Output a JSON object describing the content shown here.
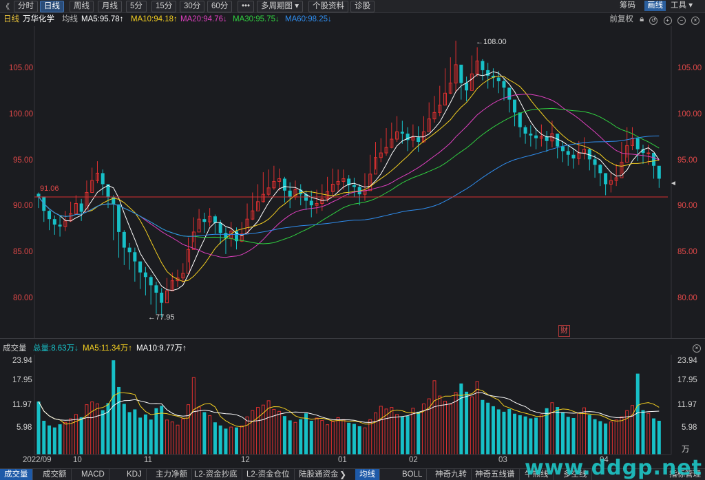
{
  "toolbar": {
    "back_glyph": "《",
    "tabs": [
      "分时",
      "日线",
      "周线",
      "月线",
      "5分",
      "15分",
      "30分",
      "60分",
      "•••",
      "多周期图 ▾",
      "个股资料",
      "诊股"
    ],
    "active_tab": "日线",
    "right": [
      "筹码",
      "画线",
      "工具 ▾"
    ],
    "active_right": "画线"
  },
  "legend": {
    "period": "日线",
    "stock_name": "万华化学",
    "ma_label": "均线",
    "ma5": "MA5:95.78↑",
    "ma10": "MA10:94.18↑",
    "ma20": "MA20:94.76↓",
    "ma30": "MA30:95.75↓",
    "ma60": "MA60:98.25↓",
    "adjust": "前复权"
  },
  "colors": {
    "up": "#e03030",
    "down": "#17c0c7",
    "ma5": "#ffffff",
    "ma10": "#f5d020",
    "ma20": "#e040c0",
    "ma30": "#30d040",
    "ma60": "#2f8ef0",
    "ref_line": "#d93030"
  },
  "price_axis": {
    "ticks": [
      "105.00",
      "100.00",
      "95.00",
      "90.00",
      "85.00",
      "80.00"
    ],
    "left_ref_label": "91.06",
    "high_label": "108.00",
    "low_label": "77.95"
  },
  "volume": {
    "title": "成交量",
    "total": "总量:8.63万↓",
    "ma5": "MA5:11.34万↑",
    "ma10": "MA10:9.77万↑",
    "ticks": [
      "23.94",
      "17.95",
      "11.97",
      "5.98"
    ],
    "unit": "万"
  },
  "dates": [
    "2022/09",
    "10",
    "11",
    "12",
    "01",
    "02",
    "03",
    "04"
  ],
  "badge": "财",
  "bottom_tabs_left": [
    "成交量",
    "成交额",
    "MACD",
    "KDJ",
    "主力净额",
    "L2-资金抄底",
    "L2-资金仓位",
    "陆股通资金"
  ],
  "active_bottom_left": "成交量",
  "bottom_tabs_right": [
    "均线",
    "BOLL",
    "神奇九转",
    "神奇五线谱",
    "牛熊线",
    "多空线"
  ],
  "active_bottom_right": "均线",
  "bottom_right_button": "指标管理",
  "watermark": "www.ddgp.net",
  "chart_data": {
    "type": "candlestick",
    "price_ylim": [
      77,
      110
    ],
    "volume_ylim": [
      0,
      26
    ],
    "closes": [
      91.06,
      89.5,
      88.6,
      88.0,
      87.8,
      88.4,
      89.2,
      90.3,
      89.4,
      91.5,
      92.8,
      93.6,
      92.4,
      91.0,
      90.2,
      87.2,
      85.5,
      85.0,
      84.0,
      82.8,
      82.3,
      81.4,
      80.6,
      79.5,
      80.8,
      81.9,
      82.2,
      82.7,
      85.3,
      87.2,
      88.6,
      88.3,
      88.9,
      88.2,
      87.1,
      86.5,
      87.3,
      86.2,
      87.0,
      88.6,
      89.5,
      90.5,
      91.3,
      92.0,
      92.7,
      93.0,
      91.7,
      91.0,
      91.8,
      91.3,
      90.6,
      90.1,
      90.3,
      90.8,
      91.6,
      92.4,
      92.7,
      93.0,
      92.3,
      92.1,
      91.3,
      91.7,
      93.5,
      95.3,
      95.8,
      96.4,
      97.3,
      98.1,
      97.9,
      97.2,
      97.5,
      97.0,
      98.1,
      99.5,
      100.2,
      101.0,
      102.3,
      103.4,
      105.4,
      103.4,
      102.6,
      104.4,
      105.8,
      104.8,
      104.2,
      104.0,
      103.6,
      102.9,
      101.6,
      100.2,
      98.6,
      97.9,
      97.7,
      97.4,
      97.6,
      97.1,
      97.9,
      96.5,
      96.0,
      95.6,
      95.2,
      95.8,
      96.2,
      95.1,
      94.5,
      93.6,
      92.4,
      92.8,
      93.1,
      94.8,
      96.6,
      97.4,
      96.2,
      95.8,
      95.8,
      94.4,
      93.0
    ],
    "highs": [
      91.5,
      90.3,
      89.6,
      89.0,
      89.0,
      89.5,
      90.5,
      91.2,
      90.8,
      92.8,
      94.2,
      94.9,
      94.0,
      92.3,
      91.2,
      88.8,
      87.4,
      86.0,
      85.5,
      84.0,
      83.4,
      82.5,
      81.8,
      81.1,
      82.2,
      82.8,
      83.1,
      83.8,
      86.6,
      88.8,
      89.7,
      89.3,
      89.8,
      89.1,
      88.5,
      87.7,
      88.3,
      87.7,
      88.3,
      90.3,
      91.5,
      92.4,
      93.7,
      94.0,
      94.4,
      94.1,
      93.2,
      92.6,
      92.8,
      92.4,
      91.7,
      91.7,
      91.8,
      92.4,
      93.2,
      94.1,
      94.0,
      94.0,
      93.4,
      93.1,
      92.4,
      93.6,
      95.6,
      97.0,
      97.4,
      98.5,
      99.1,
      99.8,
      99.3,
      98.6,
      98.9,
      98.7,
      99.8,
      101.3,
      102.0,
      103.1,
      105.0,
      106.2,
      108.0,
      105.3,
      104.1,
      106.4,
      107.3,
      106.0,
      105.6,
      105.0,
      104.7,
      103.9,
      102.8,
      101.3,
      99.7,
      98.8,
      98.8,
      98.5,
      98.9,
      98.2,
      99.3,
      97.6,
      97.0,
      96.7,
      96.3,
      97.1,
      97.5,
      96.3,
      95.6,
      94.6,
      93.6,
      93.7,
      94.6,
      97.0,
      98.6,
      98.6,
      97.3,
      96.7,
      96.7,
      95.3,
      94.0
    ],
    "lows": [
      89.8,
      88.3,
      87.4,
      86.9,
      86.7,
      87.3,
      88.3,
      89.2,
      88.4,
      90.0,
      91.6,
      92.5,
      91.2,
      89.8,
      86.3,
      84.4,
      83.6,
      83.1,
      81.8,
      81.0,
      80.3,
      79.3,
      78.3,
      77.95,
      79.8,
      80.9,
      81.2,
      81.7,
      83.9,
      86.1,
      87.5,
      87.1,
      87.8,
      87.0,
      85.9,
      84.8,
      85.6,
      85.3,
      86.1,
      87.8,
      88.5,
      89.6,
      90.4,
      91.1,
      91.8,
      91.7,
      90.4,
      89.8,
      90.7,
      90.1,
      89.6,
      88.8,
      89.2,
      89.5,
      90.5,
      91.2,
      91.6,
      91.8,
      91.2,
      91.0,
      90.1,
      90.6,
      92.2,
      94.0,
      94.8,
      95.5,
      96.3,
      97.0,
      96.8,
      96.0,
      96.4,
      95.9,
      96.9,
      98.2,
      99.1,
      99.8,
      101.0,
      102.2,
      102.4,
      101.6,
      101.4,
      102.7,
      104.1,
      103.7,
      102.8,
      102.9,
      102.3,
      101.5,
      100.2,
      98.7,
      97.5,
      96.8,
      96.5,
      96.2,
      96.5,
      95.9,
      96.4,
      95.2,
      94.8,
      94.4,
      94.1,
      94.5,
      95.1,
      93.9,
      93.1,
      92.2,
      91.2,
      91.5,
      92.2,
      93.5,
      95.3,
      96.1,
      94.9,
      94.6,
      94.5,
      93.0,
      92.0
    ],
    "volumes": [
      13.5,
      8.6,
      7.4,
      6.9,
      7.7,
      8.2,
      9.1,
      10.2,
      9.5,
      12.7,
      13.4,
      12.9,
      11.3,
      13.1,
      24.0,
      17.2,
      12.9,
      10.8,
      11.5,
      9.4,
      10.2,
      8.9,
      11.8,
      12.4,
      8.8,
      8.3,
      7.5,
      9.1,
      12.7,
      19.6,
      12.1,
      10.8,
      9.9,
      8.2,
      7.4,
      6.6,
      7.0,
      6.9,
      7.3,
      9.6,
      11.2,
      12.0,
      12.6,
      13.7,
      11.5,
      11.0,
      9.8,
      8.7,
      8.2,
      9.0,
      10.5,
      8.6,
      9.3,
      8.7,
      7.6,
      8.4,
      9.4,
      8.9,
      8.1,
      7.8,
      7.2,
      6.8,
      8.9,
      10.6,
      12.3,
      11.6,
      12.0,
      10.2,
      9.6,
      9.8,
      11.8,
      10.9,
      12.9,
      14.2,
      18.8,
      14.9,
      13.6,
      12.8,
      15.8,
      18.1,
      16.0,
      14.7,
      18.6,
      13.9,
      13.2,
      12.3,
      11.5,
      10.9,
      11.6,
      10.4,
      10.0,
      9.7,
      9.2,
      9.4,
      10.1,
      11.8,
      13.2,
      12.1,
      10.8,
      9.6,
      9.3,
      10.6,
      11.9,
      10.1,
      9.0,
      8.5,
      7.9,
      8.3,
      8.8,
      9.6,
      11.2,
      12.5,
      20.6,
      11.3,
      10.5,
      9.2,
      8.6
    ]
  }
}
